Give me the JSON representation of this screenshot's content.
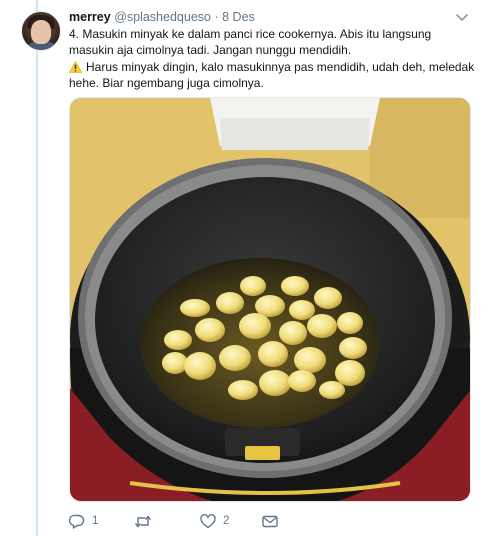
{
  "tweet": {
    "name": "merrey",
    "handle": "@splashedqueso",
    "separator": "·",
    "date": "8 Des",
    "paragraph_1": "4. Masukin minyak ke dalam panci rice cookernya. Abis itu langsung masukin aja cimolnya tadi. Jangan nunggu mendidih.",
    "paragraph_2": "Harus minyak dingin, kalo masukinnya pas mendidih, udah deh, meledak hehe. Biar ngembang juga cimolnya.",
    "warning_icon": "warning-icon",
    "colors": {
      "text": "#14171a",
      "muted": "#657786",
      "rail": "#cfe7f4",
      "warning": "#ffcc33"
    }
  },
  "actions": {
    "reply_count": "1",
    "retweet_count": "",
    "like_count": "2",
    "icons": [
      "reply-icon",
      "retweet-icon",
      "like-icon",
      "message-icon"
    ]
  }
}
